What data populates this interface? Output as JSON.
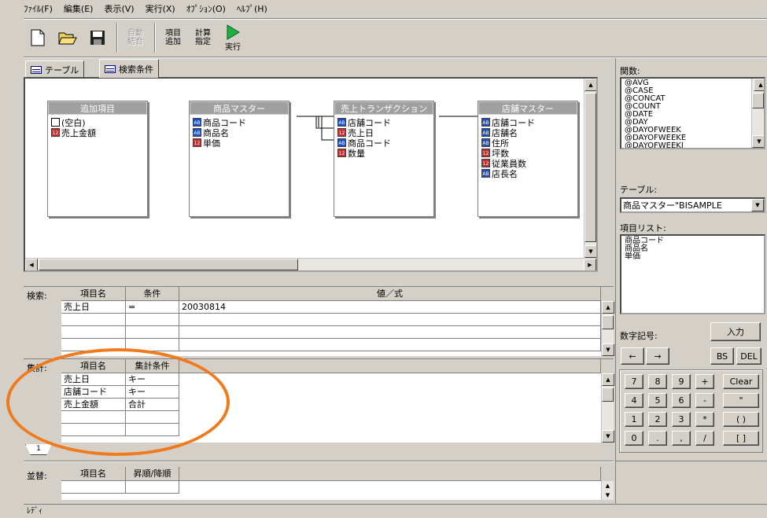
{
  "menu": [
    "ﾌｧｲﾙ(F)",
    "編集(E)",
    "表示(V)",
    "実行(X)",
    "ｵﾌﾟｼｮﾝ(O)",
    "ﾍﾙﾌﾟ(H)"
  ],
  "toolbar": {
    "auto_join_label": "自動\n結合",
    "add_item_label": "項目\n追加",
    "calc_label": "計算\n指定",
    "run_label": "実行"
  },
  "tabs": [
    "テーブル",
    "検索条件"
  ],
  "tables": [
    {
      "title": "追加項目",
      "items": [
        {
          "type": "blank",
          "label": "(空白)"
        },
        {
          "type": "num",
          "label": "売上金額"
        }
      ]
    },
    {
      "title": "商品マスター",
      "items": [
        {
          "type": "ab",
          "label": "商品コード"
        },
        {
          "type": "ab",
          "label": "商品名"
        },
        {
          "type": "num",
          "label": "単価"
        }
      ]
    },
    {
      "title": "売上トランザクション",
      "items": [
        {
          "type": "ab",
          "label": "店舗コード"
        },
        {
          "type": "num",
          "label": "売上日"
        },
        {
          "type": "ab",
          "label": "商品コード"
        },
        {
          "type": "num",
          "label": "数量"
        }
      ]
    },
    {
      "title": "店舗マスター",
      "items": [
        {
          "type": "ab",
          "label": "店舗コード"
        },
        {
          "type": "ab",
          "label": "店舗名"
        },
        {
          "type": "ab",
          "label": "住所"
        },
        {
          "type": "num",
          "label": "坪数"
        },
        {
          "type": "num",
          "label": "従業員数"
        },
        {
          "type": "ab",
          "label": "店長名"
        }
      ]
    }
  ],
  "search": {
    "label": "検索:",
    "headers": [
      "項目名",
      "条件",
      "値／式"
    ],
    "rows": [
      {
        "item": "売上日",
        "cond": "=",
        "value": "20030814"
      }
    ]
  },
  "aggregate": {
    "label": "集計:",
    "headers": [
      "項目名",
      "集計条件"
    ],
    "rows": [
      {
        "item": "売上日",
        "cond": "キー"
      },
      {
        "item": "店舗コード",
        "cond": "キー"
      },
      {
        "item": "売上金額",
        "cond": "合計"
      }
    ],
    "tab": "1"
  },
  "sort": {
    "label": "並替:",
    "headers": [
      "項目名",
      "昇順/降順"
    ]
  },
  "right_panel": {
    "functions_label": "関数:",
    "functions": [
      "@AVG",
      "@CASE",
      "@CONCAT",
      "@COUNT",
      "@DATE",
      "@DAY",
      "@DAYOFWEEK",
      "@DAYOFWEEKE",
      "@DAYOFWEEKJ"
    ],
    "table_label": "テーブル:",
    "table_value": "商品マスター\"BISAMPLE",
    "itemlist_label": "項目リスト:",
    "itemlist": [
      "商品コード",
      "商品名",
      "単価"
    ],
    "numsym_label": "数字記号:",
    "input_button": "入力",
    "left_arrow": "←",
    "right_arrow": "→",
    "bs": "BS",
    "del": "DEL",
    "keys": [
      [
        "7",
        "8",
        "9",
        "+"
      ],
      [
        "4",
        "5",
        "6",
        "-"
      ],
      [
        "1",
        "2",
        "3",
        "*"
      ],
      [
        "0",
        ".",
        ",",
        "/"
      ]
    ],
    "clear": "Clear",
    "quote": "\"",
    "paren": "( )",
    "bracket": "[ ]"
  },
  "status": "ﾚﾃﾞｨ"
}
